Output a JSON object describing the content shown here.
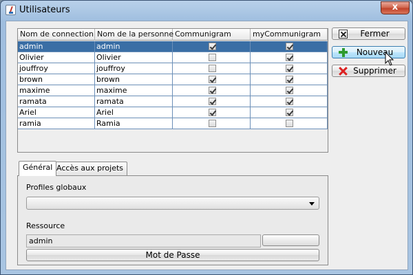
{
  "window": {
    "title": "Utilisateurs",
    "close_glyph": "x"
  },
  "table": {
    "columns": [
      "Nom de connection",
      "Nom de la personne",
      "Communigram",
      "myCommunigram"
    ],
    "rows": [
      {
        "login": "admin",
        "name": "admin",
        "communigram": true,
        "mycommunigram": true,
        "selected": true
      },
      {
        "login": "Olivier",
        "name": "Olivier",
        "communigram": false,
        "mycommunigram": true,
        "selected": false
      },
      {
        "login": "jouffroy",
        "name": "jouffroy",
        "communigram": false,
        "mycommunigram": true,
        "selected": false
      },
      {
        "login": "brown",
        "name": "brown",
        "communigram": true,
        "mycommunigram": true,
        "selected": false
      },
      {
        "login": "maxime",
        "name": "maxime",
        "communigram": true,
        "mycommunigram": true,
        "selected": false
      },
      {
        "login": "ramata",
        "name": "ramata",
        "communigram": true,
        "mycommunigram": true,
        "selected": false
      },
      {
        "login": "Ariel",
        "name": "Ariel",
        "communigram": true,
        "mycommunigram": true,
        "selected": false
      },
      {
        "login": "ramia",
        "name": "Ramia",
        "communigram": false,
        "mycommunigram": false,
        "selected": false
      }
    ]
  },
  "actions": {
    "close_label": "Fermer",
    "new_label": "Nouveau",
    "delete_label": "Supprimer",
    "close_icon": "window-close-icon",
    "new_icon": "plus-icon",
    "delete_icon": "delete-x-icon"
  },
  "tabs": [
    {
      "label": "Général",
      "active": true
    },
    {
      "label": "Accès aux projets",
      "active": false
    }
  ],
  "general": {
    "profiles_label": "Profiles globaux",
    "profiles_value": "",
    "resource_label": "Ressource",
    "resource_value": "admin",
    "password_button": "Mot de Passe"
  },
  "colors": {
    "selection": "#3a6ea5",
    "grid": "#6b8fb8",
    "close_button": "#c1432b"
  }
}
